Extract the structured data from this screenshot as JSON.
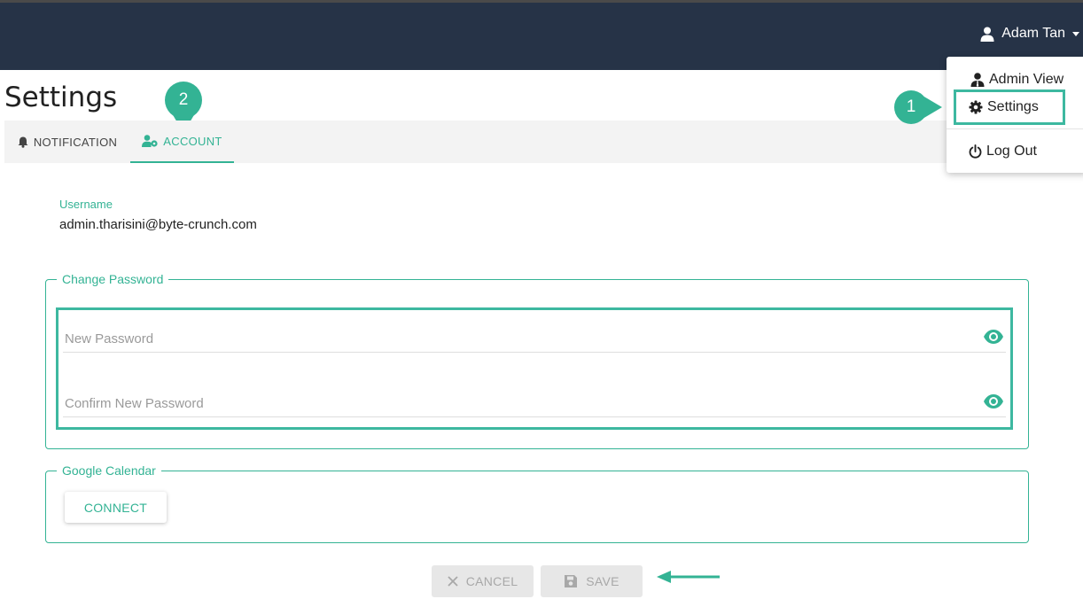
{
  "header": {
    "user_name": "Adam Tan",
    "user_icon": "user-icon"
  },
  "dropdown": {
    "items": [
      {
        "label": "Admin View",
        "icon": "user-tie-icon"
      },
      {
        "label": "Settings",
        "icon": "gear-icon"
      },
      {
        "label": "Log Out",
        "icon": "power-icon"
      }
    ]
  },
  "page": {
    "title": "Settings"
  },
  "tabs": [
    {
      "label": "NOTIFICATION",
      "icon": "bell-icon",
      "active": false
    },
    {
      "label": "ACCOUNT",
      "icon": "user-cog-icon",
      "active": true
    }
  ],
  "account": {
    "username_label": "Username",
    "username_value": "admin.tharisini@byte-crunch.com",
    "change_password": {
      "legend": "Change Password",
      "new_password_placeholder": "New Password",
      "confirm_password_placeholder": "Confirm New Password"
    },
    "google_calendar": {
      "legend": "Google Calendar",
      "connect_label": "CONNECT"
    }
  },
  "actions": {
    "cancel_label": "CANCEL",
    "save_label": "SAVE"
  },
  "callouts": {
    "step1": "1",
    "step2": "2"
  },
  "colors": {
    "navbar": "#263347",
    "accent": "#33b394",
    "highlight": "#3db8a0",
    "disabled_bg": "#e7e7e7"
  }
}
